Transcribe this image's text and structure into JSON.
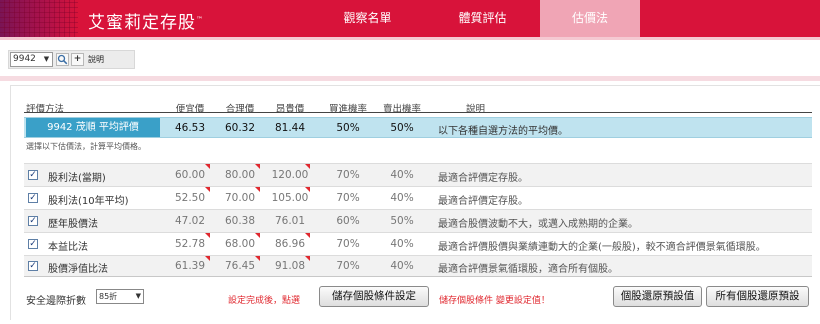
{
  "header": {
    "logo": "艾蜜莉定存股",
    "logo_mark": "™",
    "nav": {
      "watch": "觀察名單",
      "health": "體質評估",
      "value": "估價法"
    },
    "accent_color": "#d8133a"
  },
  "toolbar": {
    "stock_code": "9942",
    "stock_dropdown_icon": "chevron-down-icon",
    "search_icon": "magnifier",
    "add_icon": "plus",
    "help": "說明"
  },
  "table": {
    "headers": {
      "method": "評價方法",
      "cheap": "便宜價",
      "fair": "合理價",
      "expensive": "昂貴價",
      "buy_rate": "買進機率",
      "sell_rate": "賣出機率",
      "desc": "說明"
    },
    "average": {
      "name": "9942 茂順 平均評價",
      "cheap": "46.53",
      "fair": "60.32",
      "expensive": "81.44",
      "buy": "50%",
      "sell": "50%",
      "desc": "以下各種自選方法的平均價。"
    },
    "hint": "選擇以下估價法，計算平均價格。",
    "rows": [
      {
        "checked": true,
        "name": "股利法(當期)",
        "cheap": "60.00",
        "fair": "80.00",
        "expensive": "120.00",
        "buy": "70%",
        "sell": "40%",
        "desc": "最適合評價定存股。"
      },
      {
        "checked": true,
        "name": "股利法(10年平均)",
        "cheap": "52.50",
        "fair": "70.00",
        "expensive": "105.00",
        "buy": "70%",
        "sell": "40%",
        "desc": "最適合評價定存股。"
      },
      {
        "checked": true,
        "name": "歷年股價法",
        "cheap": "47.02",
        "fair": "60.38",
        "expensive": "76.01",
        "buy": "60%",
        "sell": "50%",
        "desc": "最適合股價波動不大，或邁入成熟期的企業。"
      },
      {
        "checked": true,
        "name": "本益比法",
        "cheap": "52.78",
        "fair": "68.00",
        "expensive": "86.96",
        "buy": "70%",
        "sell": "40%",
        "desc": "最適合評價股價與業績連動大的企業(一般股)，較不適合評價景氣循環股。"
      },
      {
        "checked": true,
        "name": "股價淨值比法",
        "cheap": "61.39",
        "fair": "76.45",
        "expensive": "91.08",
        "buy": "70%",
        "sell": "40%",
        "desc": "最適合評價景氣循環股，適合所有個股。"
      }
    ]
  },
  "footer": {
    "safety_label": "安全邊際折數",
    "discount_value": "85折",
    "note_left": "設定完成後，點選",
    "save_button": "儲存個股條件設定",
    "note_right": "儲存個股條件 變更設定值！",
    "reset_button": "個股還原預設值",
    "reset_all_button": "所有個股還原預設"
  }
}
